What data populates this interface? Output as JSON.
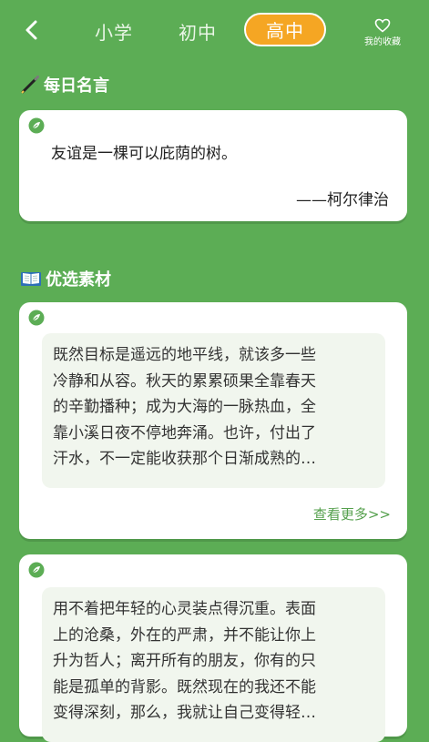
{
  "colors": {
    "background": "#5cad55",
    "active_tab": "#f5a623",
    "link": "#55a04d",
    "excerpt_bg": "#f1f6ee"
  },
  "header": {
    "back_icon": "chevron-left-icon",
    "tabs": [
      {
        "label": "小学",
        "active": false
      },
      {
        "label": "初中",
        "active": false
      },
      {
        "label": "高中",
        "active": true
      }
    ],
    "favorites": {
      "icon": "heart-icon",
      "label": "我的收藏"
    }
  },
  "daily_quote": {
    "title": "每日名言",
    "icon": "pen-icon",
    "text": "友谊是一棵可以庇荫的树。",
    "author": "——柯尔律治"
  },
  "materials": {
    "title": "优选素材",
    "icon": "open-book-icon",
    "items": [
      {
        "lines": [
          "既然目标是遥远的地平线，就该多一些",
          "冷静和从容。秋天的累累硕果全靠春天",
          "的辛勤播种；成为大海的一脉热血，全",
          "靠小溪日夜不停地奔涌。也许，付出了",
          "汗水，不一定能收获那个日渐成熟的…"
        ],
        "more_label": "查看更多>>"
      },
      {
        "lines": [
          "用不着把年轻的心灵装点得沉重。表面",
          "上的沧桑，外在的严肃，并不能让你上",
          "升为哲人；离开所有的朋友，你有的只",
          "能是孤单的背影。既然现在的我还不能",
          "变得深刻，那么，我就让自己变得轻…"
        ]
      }
    ]
  }
}
